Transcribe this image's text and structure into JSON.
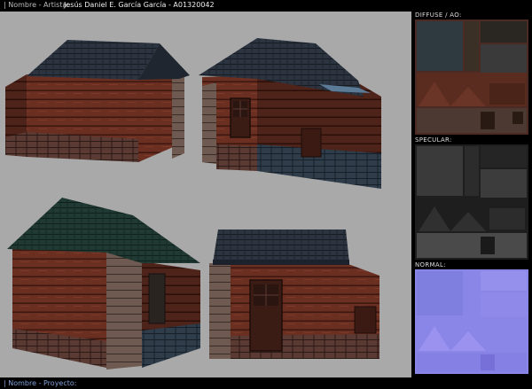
{
  "header": {
    "label": "| Nombre - Artista:",
    "value": "Jesús Daniel E. García García - A01320042"
  },
  "panels": {
    "diffuse_label": "DIFFUSE / AO:",
    "specular_label": "SPECULAR:",
    "normal_label": "NORMAL:"
  },
  "footer": {
    "label": "| Nombre - Proyecto:"
  }
}
